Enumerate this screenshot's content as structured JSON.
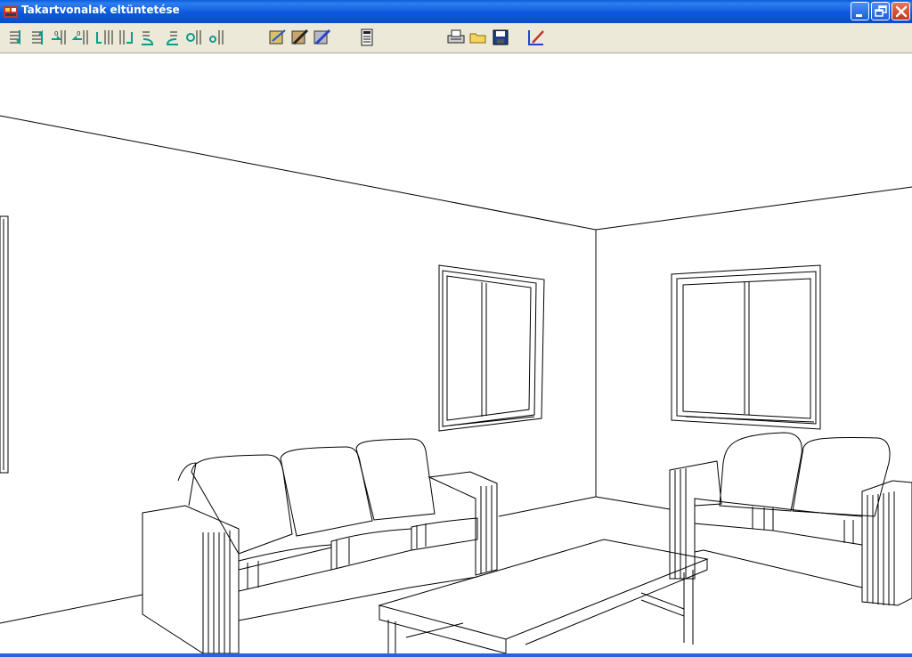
{
  "window": {
    "title": "Takartvonalak eltüntetése",
    "app_icon": "drafting-app-icon",
    "controls": [
      {
        "name": "minimize-button",
        "icon": "minimize-icon"
      },
      {
        "name": "restore-button",
        "icon": "restore-icon"
      },
      {
        "name": "close-button",
        "icon": "close-icon"
      }
    ]
  },
  "toolbar": {
    "groups": [
      {
        "name": "view-navigation",
        "buttons": [
          "move-down-icon",
          "move-up-icon",
          "rotate-left-icon",
          "rotate-right-icon",
          "tilt-down-icon",
          "tilt-up-icon",
          "turn-left-icon",
          "turn-right-icon",
          "zoom-in-icon",
          "zoom-out-icon"
        ]
      },
      {
        "name": "render-modes",
        "buttons": [
          "hidden-line-icon",
          "pencil-draw-icon",
          "pen-draw-icon"
        ]
      },
      {
        "name": "calc",
        "buttons": [
          "calculator-icon"
        ]
      },
      {
        "name": "file",
        "buttons": [
          "print-icon",
          "open-folder-icon",
          "save-disk-icon"
        ]
      },
      {
        "name": "misc",
        "buttons": [
          "exit-edit-icon"
        ]
      }
    ]
  },
  "colors": {
    "titlebar": "#0a4ec6",
    "toolbar": "#ece9d8",
    "canvas": "#ffffff",
    "lines": "#000000",
    "close": "#c6341a"
  }
}
